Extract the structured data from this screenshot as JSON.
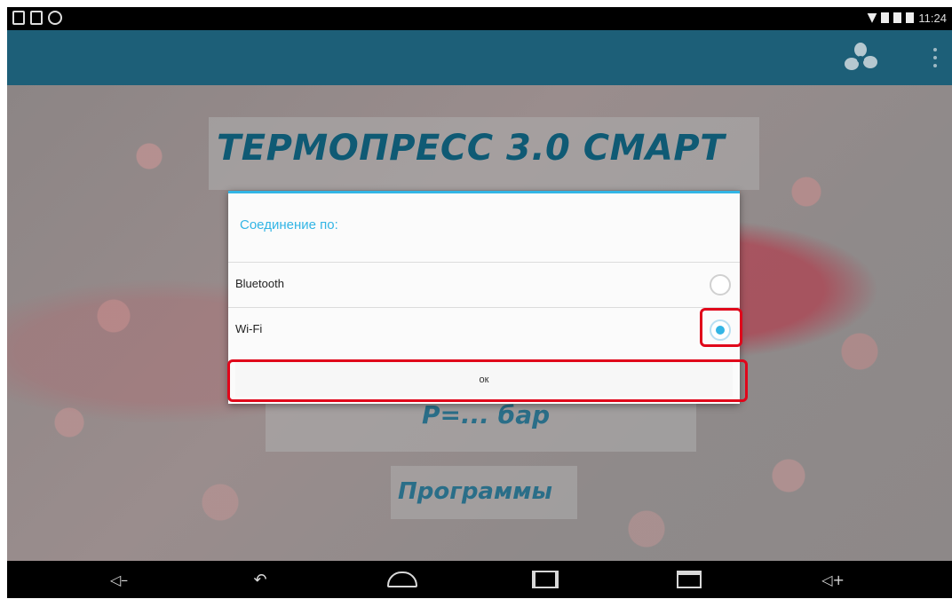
{
  "status_bar": {
    "time": "11:24"
  },
  "app": {
    "title": "ТЕРМОПРЕСС 3.0 СМАРТ",
    "pressure_label": "Р=... бар",
    "programs_label": "Программы"
  },
  "dialog": {
    "title": "Соединение по:",
    "options": [
      {
        "label": "Bluetooth",
        "checked": false
      },
      {
        "label": "Wi-Fi",
        "checked": true
      }
    ],
    "ok_label": "ок"
  },
  "icons": {
    "action_bar": [
      "fan-icon",
      "overflow-menu-icon"
    ],
    "navigation": [
      "volume-down-icon",
      "back-icon",
      "home-icon",
      "screenshot-icon",
      "recent-apps-icon",
      "volume-up-icon"
    ]
  },
  "colors": {
    "action_bar": "#1d5f78",
    "accent": "#33b5e5",
    "highlight": "#e0061a",
    "title_text": "#0f5a74"
  }
}
